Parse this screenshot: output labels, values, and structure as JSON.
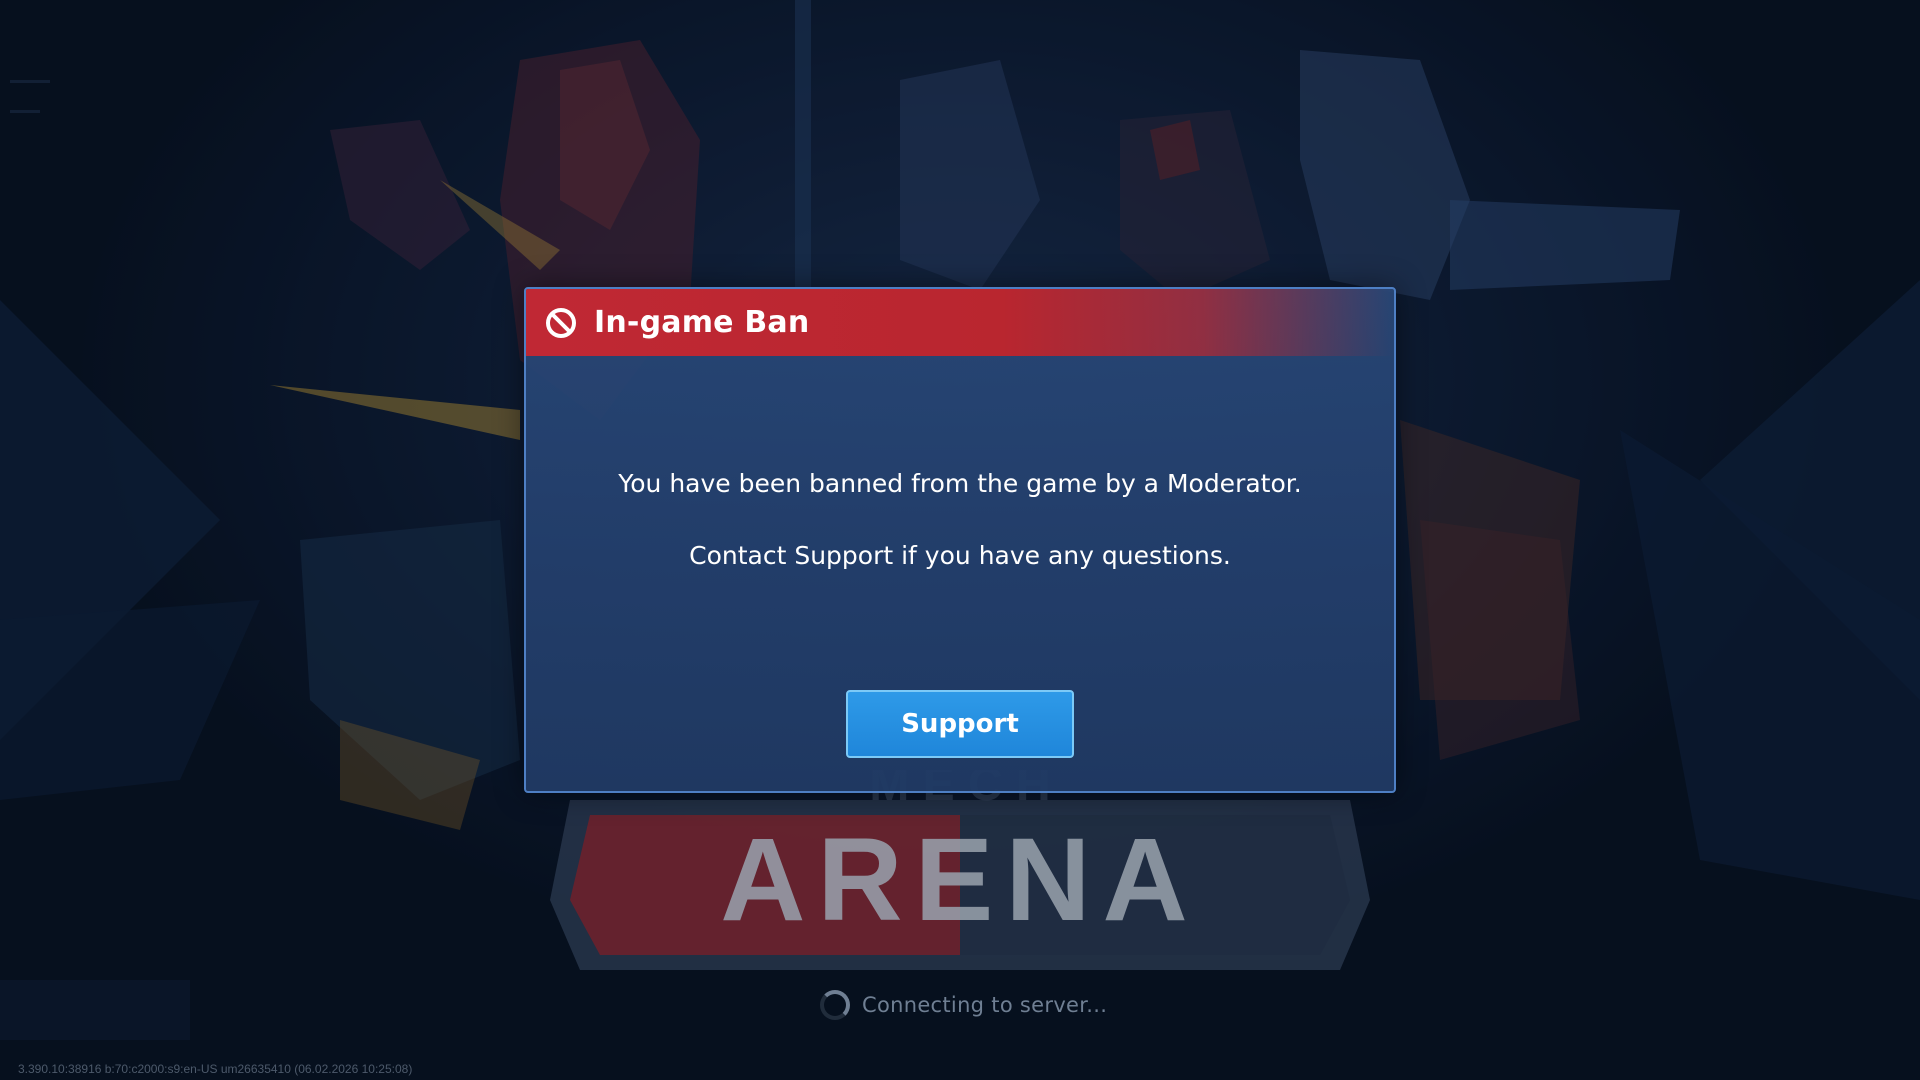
{
  "modal": {
    "title": "In-game Ban",
    "icon": "ban-icon",
    "message_line1": "You have been banned from the game by a Moderator.",
    "message_line2": "Contact Support if you have any questions.",
    "support_label": "Support",
    "header_color": "#c02834",
    "button_color": "#2a93e4"
  },
  "logo": {
    "text": "ARENA",
    "upper_text": "MECH"
  },
  "status": {
    "connecting_text": "Connecting to server...",
    "spinner_icon": "spinner-icon"
  },
  "footer": {
    "version_text": "3.390.10:38916 b:70:c2000:s9:en-US um26635410 (06.02.2026 10:25:08)"
  }
}
